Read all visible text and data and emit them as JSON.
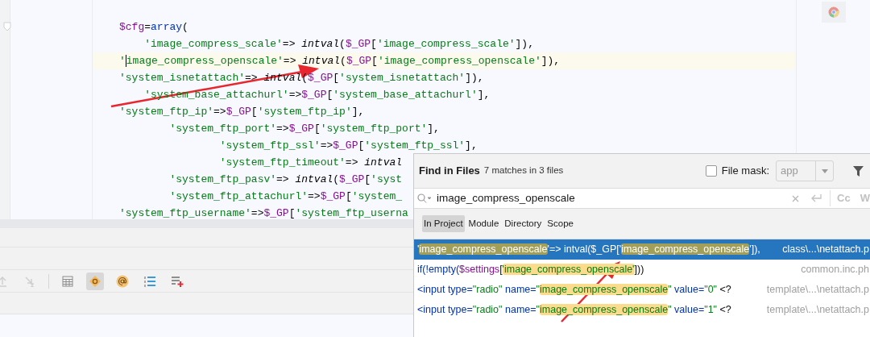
{
  "editor": {
    "lines": [
      {
        "current": false,
        "tokens": [
          {
            "t": "$cfg",
            "kind": "variable"
          },
          {
            "t": "=",
            "kind": "plain"
          },
          {
            "t": "array",
            "kind": "keyword"
          },
          {
            "t": "(",
            "kind": "plain"
          }
        ]
      },
      {
        "current": false,
        "tokens": [
          {
            "t": "    'image_compress_scale'",
            "kind": "string"
          },
          {
            "t": "=> ",
            "kind": "plain"
          },
          {
            "t": "intval",
            "kind": "function"
          },
          {
            "t": "(",
            "kind": "plain"
          },
          {
            "t": "$_GP",
            "kind": "variable"
          },
          {
            "t": "[",
            "kind": "plain"
          },
          {
            "t": "'image_compress_scale'",
            "kind": "string"
          },
          {
            "t": "]),",
            "kind": "plain"
          }
        ]
      },
      {
        "current": true,
        "tokens": [
          {
            "t": "'",
            "kind": "string"
          },
          {
            "t": "image_compress_openscale'",
            "kind": "string",
            "caret": true
          },
          {
            "t": "=> ",
            "kind": "plain"
          },
          {
            "t": "intval",
            "kind": "function"
          },
          {
            "t": "(",
            "kind": "plain"
          },
          {
            "t": "$_GP",
            "kind": "variable"
          },
          {
            "t": "[",
            "kind": "plain"
          },
          {
            "t": "'image_compress_openscale'",
            "kind": "string"
          },
          {
            "t": "]),",
            "kind": "plain"
          }
        ]
      },
      {
        "current": false,
        "tokens": [
          {
            "t": "'system_isnetattach'",
            "kind": "string"
          },
          {
            "t": "=> ",
            "kind": "plain"
          },
          {
            "t": "intval",
            "kind": "function"
          },
          {
            "t": "(",
            "kind": "plain"
          },
          {
            "t": "$_GP",
            "kind": "variable"
          },
          {
            "t": "[",
            "kind": "plain"
          },
          {
            "t": "'system_isnetattach'",
            "kind": "string"
          },
          {
            "t": "]),",
            "kind": "plain"
          }
        ]
      },
      {
        "current": false,
        "tokens": [
          {
            "t": "    'system_base_attachurl'",
            "kind": "string"
          },
          {
            "t": "=>",
            "kind": "plain"
          },
          {
            "t": "$_GP",
            "kind": "variable"
          },
          {
            "t": "[",
            "kind": "plain"
          },
          {
            "t": "'system_base_attachurl'",
            "kind": "string"
          },
          {
            "t": "],",
            "kind": "plain"
          }
        ]
      },
      {
        "current": false,
        "tokens": [
          {
            "t": "'system_ftp_ip'",
            "kind": "string"
          },
          {
            "t": "=>",
            "kind": "plain"
          },
          {
            "t": "$_GP",
            "kind": "variable"
          },
          {
            "t": "[",
            "kind": "plain"
          },
          {
            "t": "'system_ftp_ip'",
            "kind": "string"
          },
          {
            "t": "],",
            "kind": "plain"
          }
        ]
      },
      {
        "current": false,
        "tokens": [
          {
            "t": "        'system_ftp_port'",
            "kind": "string"
          },
          {
            "t": "=>",
            "kind": "plain"
          },
          {
            "t": "$_GP",
            "kind": "variable"
          },
          {
            "t": "[",
            "kind": "plain"
          },
          {
            "t": "'system_ftp_port'",
            "kind": "string"
          },
          {
            "t": "],",
            "kind": "plain"
          }
        ]
      },
      {
        "current": false,
        "tokens": [
          {
            "t": "                'system_ftp_ssl'",
            "kind": "string"
          },
          {
            "t": "=>",
            "kind": "plain"
          },
          {
            "t": "$_GP",
            "kind": "variable"
          },
          {
            "t": "[",
            "kind": "plain"
          },
          {
            "t": "'system_ftp_ssl'",
            "kind": "string"
          },
          {
            "t": "],",
            "kind": "plain"
          }
        ]
      },
      {
        "current": false,
        "tokens": [
          {
            "t": "                'system_ftp_timeout'",
            "kind": "string"
          },
          {
            "t": "=> ",
            "kind": "plain"
          },
          {
            "t": "intval",
            "kind": "function"
          }
        ]
      },
      {
        "current": false,
        "tokens": [
          {
            "t": "        'system_ftp_pasv'",
            "kind": "string"
          },
          {
            "t": "=> ",
            "kind": "plain"
          },
          {
            "t": "intval",
            "kind": "function"
          },
          {
            "t": "(",
            "kind": "plain"
          },
          {
            "t": "$_GP",
            "kind": "variable"
          },
          {
            "t": "[",
            "kind": "plain"
          },
          {
            "t": "'syst",
            "kind": "string"
          }
        ]
      },
      {
        "current": false,
        "tokens": [
          {
            "t": "        'system_ftp_attachurl'",
            "kind": "string"
          },
          {
            "t": "=>",
            "kind": "plain"
          },
          {
            "t": "$_GP",
            "kind": "variable"
          },
          {
            "t": "[",
            "kind": "plain"
          },
          {
            "t": "'system_",
            "kind": "string"
          }
        ]
      },
      {
        "current": false,
        "tokens": [
          {
            "t": "'system_ftp_username'",
            "kind": "string"
          },
          {
            "t": "=>",
            "kind": "plain"
          },
          {
            "t": "$_GP",
            "kind": "variable"
          },
          {
            "t": "[",
            "kind": "plain"
          },
          {
            "t": "'system_ftp_userna",
            "kind": "string"
          }
        ]
      }
    ]
  },
  "toolbar": [
    {
      "kind": "up",
      "selected": false,
      "disabled": true
    },
    {
      "kind": "down",
      "selected": false,
      "disabled": true
    },
    {
      "kind": "table",
      "selected": false,
      "disabled": false
    },
    {
      "kind": "class",
      "selected": true,
      "disabled": false
    },
    {
      "kind": "at",
      "selected": false,
      "disabled": false
    },
    {
      "kind": "list",
      "selected": false,
      "disabled": false
    },
    {
      "kind": "listadd",
      "selected": false,
      "disabled": false
    }
  ],
  "find": {
    "title": "Find in Files",
    "summary": "7 matches in 3 files",
    "file_mask": {
      "label": "File mask:",
      "checked": false,
      "value": "app"
    },
    "query": "image_compress_openscale",
    "toggle": "Cc",
    "toggle_2": "W",
    "scopes": [
      {
        "label": "In Project",
        "selected": true
      },
      {
        "label": "Module",
        "selected": false
      },
      {
        "label": "Directory",
        "selected": false
      },
      {
        "label": "Scope",
        "selected": false
      }
    ],
    "results": [
      {
        "selected": true,
        "file": "class\\...\\netattach.p",
        "tokens": [
          {
            "t": "'",
            "match": false
          },
          {
            "t": "image_compress_openscale",
            "match": true
          },
          {
            "t": "'=> intval($_GP['",
            "match": false
          },
          {
            "t": "image_compress_openscale",
            "match": true
          },
          {
            "t": "']),",
            "match": false
          }
        ]
      },
      {
        "selected": false,
        "file": "common.inc.ph",
        "tokens": [
          {
            "t": "if(!empty(",
            "kind": "keyword",
            "match": false
          },
          {
            "t": "$settings",
            "kind": "variable",
            "match": false
          },
          {
            "t": "[",
            "kind": "plain",
            "match": false
          },
          {
            "t": "'image_compress_openscale'",
            "kind": "string",
            "match": true
          },
          {
            "t": "]))",
            "kind": "plain",
            "match": false
          }
        ]
      },
      {
        "selected": false,
        "file": "template\\...\\netattach.p",
        "tokens": [
          {
            "t": "<input ",
            "kind": "keyword",
            "match": false
          },
          {
            "t": "type=",
            "kind": "keyword",
            "match": false
          },
          {
            "t": "\"radio\" ",
            "kind": "string",
            "match": false
          },
          {
            "t": "name=",
            "kind": "keyword",
            "match": false
          },
          {
            "t": "\"",
            "kind": "string",
            "match": false
          },
          {
            "t": "image_compress_openscale",
            "kind": "string",
            "match": true
          },
          {
            "t": "\" ",
            "kind": "string",
            "match": false
          },
          {
            "t": "value=",
            "kind": "keyword",
            "match": false
          },
          {
            "t": "\"0\" ",
            "kind": "string",
            "match": false
          },
          {
            "t": "<?",
            "kind": "plain",
            "match": false
          }
        ]
      },
      {
        "selected": false,
        "file": "template\\...\\netattach.p",
        "tokens": [
          {
            "t": "<input ",
            "kind": "keyword",
            "match": false
          },
          {
            "t": "type=",
            "kind": "keyword",
            "match": false
          },
          {
            "t": "\"radio\" ",
            "kind": "string",
            "match": false
          },
          {
            "t": "name=",
            "kind": "keyword",
            "match": false
          },
          {
            "t": "\"",
            "kind": "string",
            "match": false
          },
          {
            "t": "image_compress_openscale",
            "kind": "string",
            "match": true
          },
          {
            "t": "\" ",
            "kind": "string",
            "match": false
          },
          {
            "t": "value=",
            "kind": "keyword",
            "match": false
          },
          {
            "t": "\"1\" ",
            "kind": "string",
            "match": false
          },
          {
            "t": "<?",
            "kind": "plain",
            "match": false
          }
        ]
      }
    ]
  }
}
